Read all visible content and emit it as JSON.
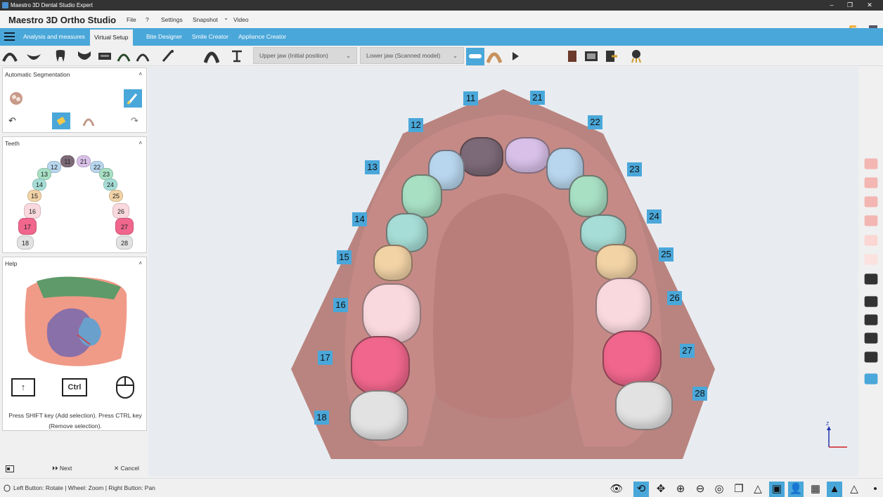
{
  "window": {
    "title": "Maestro 3D Dental Studio Expert",
    "controls": [
      "–",
      "❐",
      "✕"
    ]
  },
  "menubar": {
    "app_title": "Maestro 3D Ortho Studio",
    "items": [
      "File",
      "?",
      "Settings",
      "Snapshot",
      "Video"
    ],
    "snapshot_caret": "⌄"
  },
  "tabs": [
    "Analysis and measures",
    "Virtual Setup",
    "Bite Designer",
    "Smile Creator",
    "Appliance Creator"
  ],
  "active_tab": "Virtual Setup",
  "toolbar": {
    "upper_jaw_select": "Upper jaw (Initial position)",
    "lower_jaw_select": "Lower jaw (Scanned model)"
  },
  "panels": {
    "segmentation": {
      "title": "Automatic Segmentation",
      "collapse": "˄"
    },
    "teeth": {
      "title": "Teeth",
      "collapse": "˄"
    },
    "help": {
      "title": "Help",
      "collapse": "˄",
      "text": "Press SHIFT key (Add selection). Press CTRL key (Remove selection).",
      "shift_key": "↑",
      "ctrl_key": "Ctrl"
    }
  },
  "teeth_chart": [
    {
      "n": "11",
      "color": "#7d6a78"
    },
    {
      "n": "21",
      "color": "#d8c0e8"
    },
    {
      "n": "12",
      "color": "#b8d6ee"
    },
    {
      "n": "22",
      "color": "#b8d6ee"
    },
    {
      "n": "13",
      "color": "#a8e0c4"
    },
    {
      "n": "23",
      "color": "#a8e0c4"
    },
    {
      "n": "14",
      "color": "#a6ddd6"
    },
    {
      "n": "24",
      "color": "#a6ddd6"
    },
    {
      "n": "15",
      "color": "#f2d3a6"
    },
    {
      "n": "25",
      "color": "#f2d3a6"
    },
    {
      "n": "16",
      "color": "#f9d9de"
    },
    {
      "n": "26",
      "color": "#f9d9de"
    },
    {
      "n": "17",
      "color": "#f0668c"
    },
    {
      "n": "27",
      "color": "#f0668c"
    },
    {
      "n": "18",
      "color": "#e2e2e2"
    },
    {
      "n": "28",
      "color": "#e2e2e2"
    }
  ],
  "footer": {
    "next": "Next",
    "cancel": "Cancel"
  },
  "viewport_labels": [
    "11",
    "21",
    "12",
    "22",
    "13",
    "23",
    "14",
    "24",
    "15",
    "25",
    "16",
    "26",
    "17",
    "27",
    "18",
    "28"
  ],
  "axes": {
    "z": "Z"
  },
  "status": {
    "text": "Left Button: Rotate | Wheel: Zoom | Right Button: Pan"
  },
  "colors": {
    "accent": "#4aa7d9",
    "gum": "#c88c88",
    "base": "#b9847f"
  }
}
